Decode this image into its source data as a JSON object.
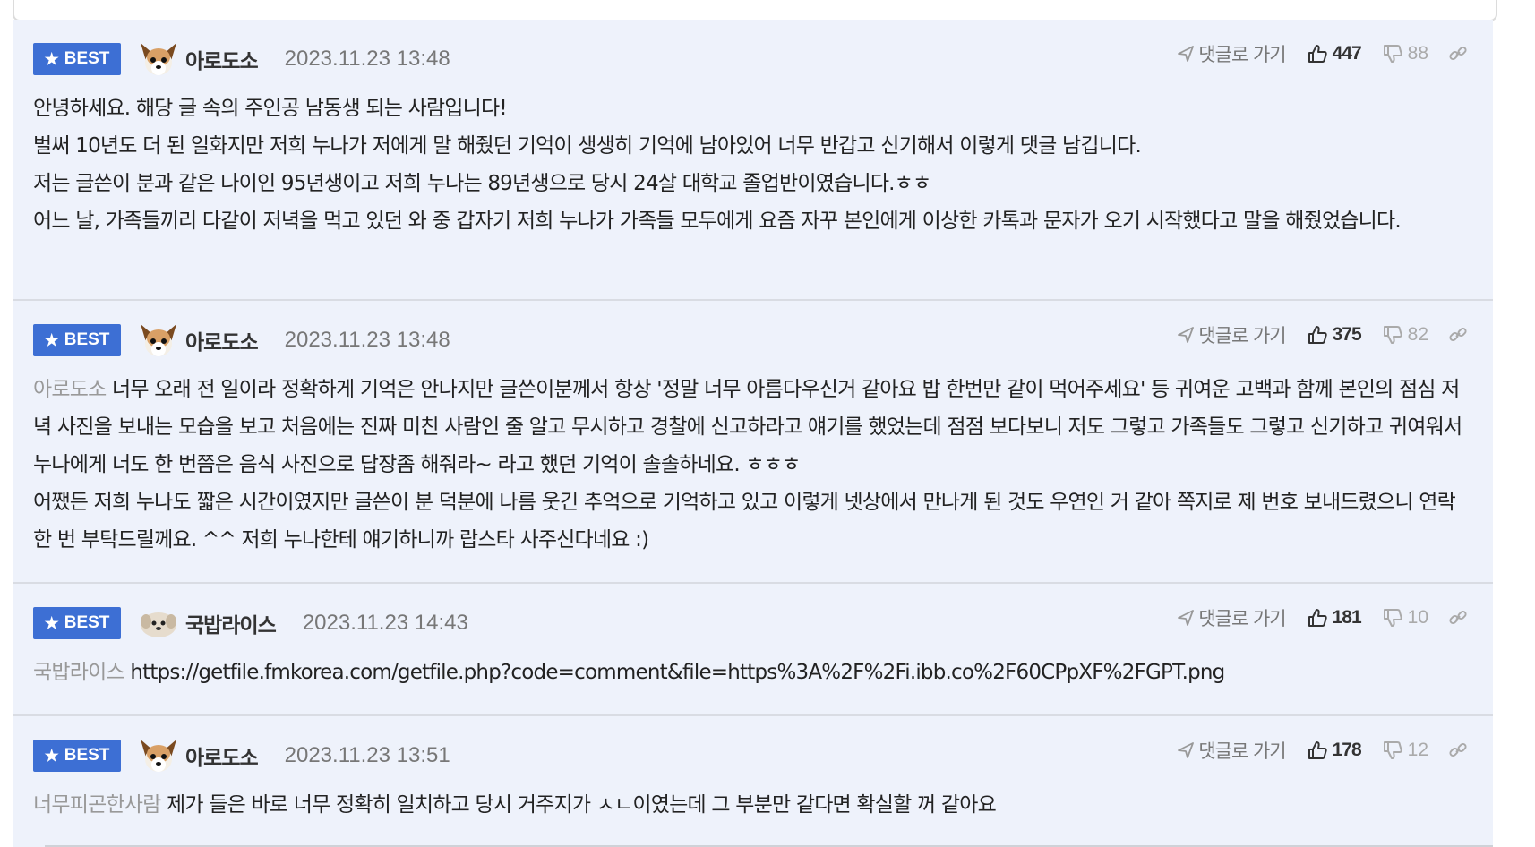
{
  "comments": [
    {
      "badge": "BEST",
      "nickname": "아로도소",
      "date": "2023.11.23 13:48",
      "reply_label": "댓글로 가기",
      "upvotes": "447",
      "downvotes": "88",
      "mention": "",
      "lines": [
        "안녕하세요. 해당 글 속의 주인공 남동생 되는 사람입니다!",
        "벌써 10년도 더 된 일화지만 저희 누나가 저에게 말 해줬던 기억이 생생히 기억에 남아있어 너무 반갑고 신기해서 이렇게 댓글 남깁니다.",
        "저는 글쓴이 분과 같은 나이인 95년생이고 저희 누나는 89년생으로 당시 24살 대학교 졸업반이였습니다.ㅎㅎ",
        "어느 날, 가족들끼리 다같이 저녁을 먹고 있던 와 중 갑자기 저희 누나가 가족들 모두에게 요즘 자꾸 본인에게 이상한 카톡과 문자가 오기 시작했다고 말을 해줬었습니다."
      ]
    },
    {
      "badge": "BEST",
      "nickname": "아로도소",
      "date": "2023.11.23 13:48",
      "reply_label": "댓글로 가기",
      "upvotes": "375",
      "downvotes": "82",
      "mention": "아로도소",
      "lines": [
        "너무 오래 전 일이라 정확하게 기억은 안나지만 글쓴이분께서 항상 '정말 너무 아름다우신거 같아요 밥 한번만 같이 먹어주세요' 등 귀여운 고백과 함께 본인의 점심 저녁 사진을 보내는 모습을 보고 처음에는 진짜 미친 사람인 줄 알고 무시하고 경찰에 신고하라고 얘기를 했었는데 점점 보다보니 저도 그렇고 가족들도 그렇고 신기하고 귀여워서 누나에게 너도 한 번쯤은 음식 사진으로 답장좀 해줘라~ 라고 했던 기억이 솔솔하네요. ㅎㅎㅎ",
        "어쨌든 저희 누나도 짧은 시간이였지만 글쓴이 분 덕분에 나름 웃긴 추억으로 기억하고 있고 이렇게 넷상에서 만나게 된 것도 우연인 거 같아 쪽지로 제 번호 보내드렸으니 연락 한 번 부탁드릴께요. ^^ 저희 누나한테 얘기하니까 랍스타 사주신다네요 :)"
      ]
    },
    {
      "badge": "BEST",
      "nickname": "국밥라이스",
      "date": "2023.11.23 14:43",
      "reply_label": "댓글로 가기",
      "upvotes": "181",
      "downvotes": "10",
      "mention": "국밥라이스",
      "lines": [
        "https://getfile.fmkorea.com/getfile.php?code=comment&file=https%3A%2F%2Fi.ibb.co%2F60CPpXF%2FGPT.png"
      ]
    },
    {
      "badge": "BEST",
      "nickname": "아로도소",
      "date": "2023.11.23 13:51",
      "reply_label": "댓글로 가기",
      "upvotes": "178",
      "downvotes": "12",
      "mention": "너무피곤한사람",
      "lines": [
        "제가 들은 바로 너무 정확히 일치하고 당시 거주지가 ㅅㄴ이였는데 그 부분만 같다면 확실할 꺼 같아요"
      ]
    }
  ],
  "colors": {
    "best_badge": "#3d6fd4",
    "comment_bg": "#eef2fb",
    "mention": "#999999"
  },
  "icons": [
    "star-icon",
    "arrow-reply-icon",
    "thumbs-up-icon",
    "thumbs-down-icon",
    "link-icon",
    "chihuahua-avatar",
    "puppy-avatar"
  ]
}
